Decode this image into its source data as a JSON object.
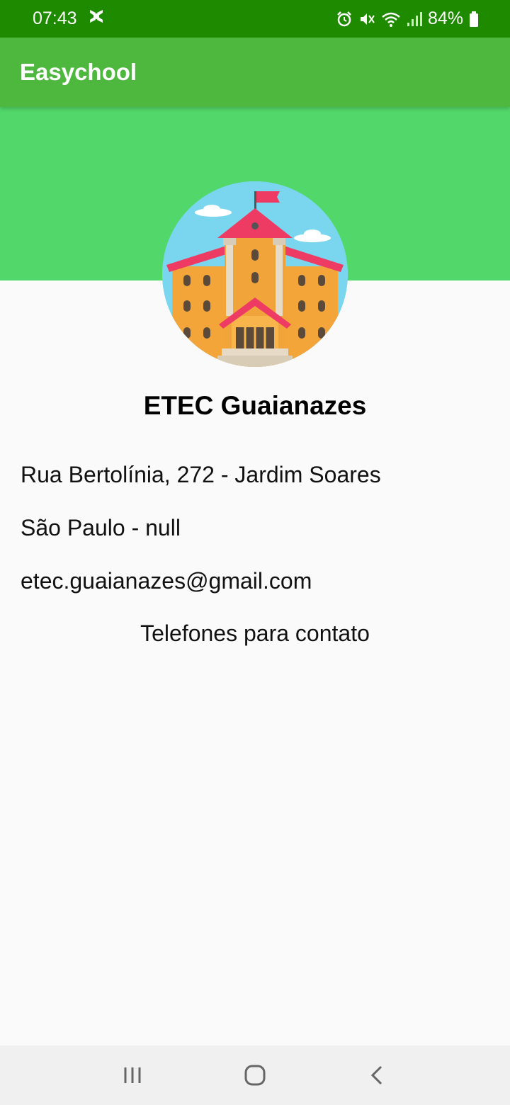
{
  "status_bar": {
    "time": "07:43",
    "battery_percent": "84%",
    "icons": [
      "notification-icon",
      "alarm-icon",
      "mute-icon",
      "wifi-icon",
      "signal-icon",
      "battery-icon"
    ]
  },
  "app_bar": {
    "title": "Easychool"
  },
  "school": {
    "name": "ETEC Guaianazes",
    "address": "Rua Bertolínia, 272 - Jardim Soares",
    "city_state": "São Paulo - null",
    "email": "etec.guaianazes@gmail.com",
    "phones_label": "Telefones para contato"
  },
  "nav_bar": {
    "icons": [
      "recents-icon",
      "home-icon",
      "back-icon"
    ]
  },
  "colors": {
    "status_bar": "#1e8a00",
    "app_bar": "#4db73e",
    "hero": "#52d86a",
    "background": "#fafafa"
  }
}
